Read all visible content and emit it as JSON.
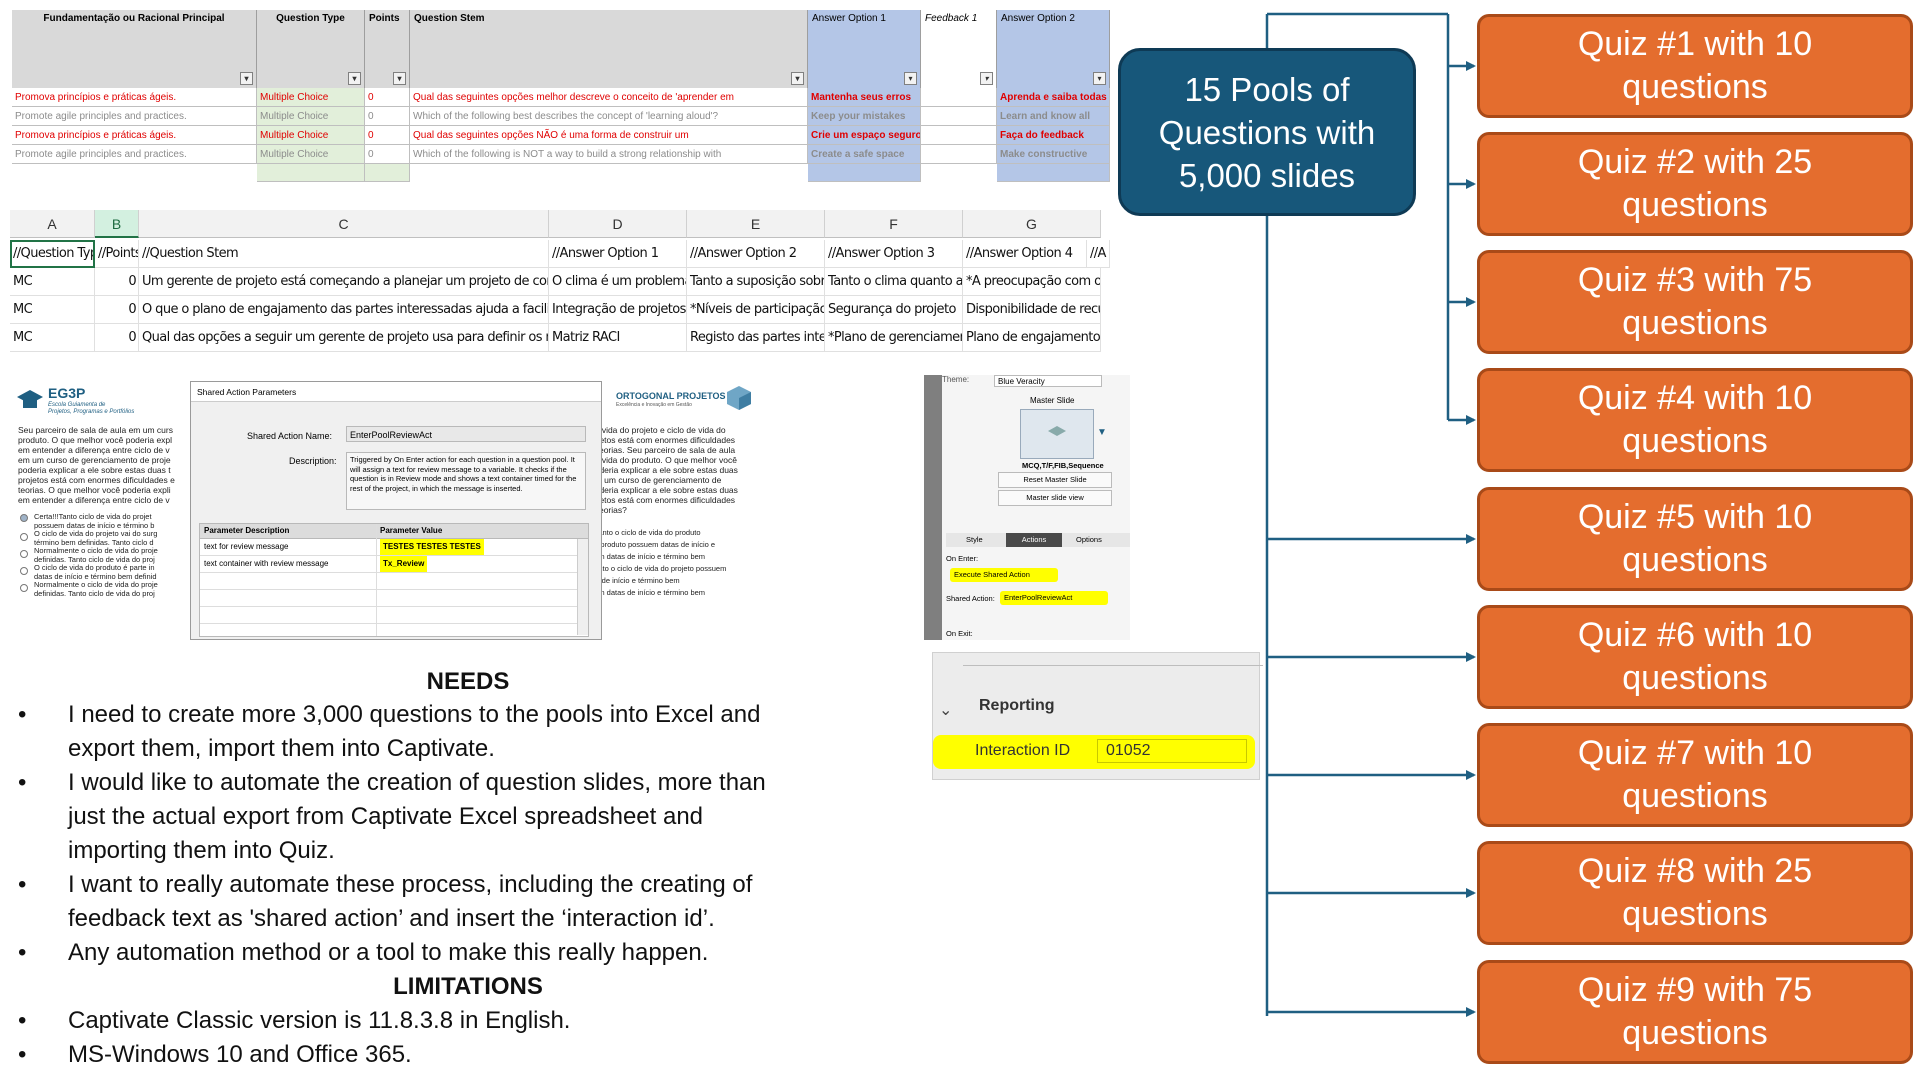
{
  "excel_top": {
    "headers": [
      "Fundamentação ou Racional Principal",
      "Question Type",
      "Points",
      "Question Stem",
      "Answer Option 1",
      "Feedback 1",
      "Answer Option 2"
    ],
    "rows": [
      [
        "Promova princípios e práticas ágeis.",
        "Multiple Choice",
        "0",
        "Qual das seguintes opções melhor descreve o conceito de 'aprender em",
        "Mantenha seus erros",
        "",
        "Aprenda e saiba todas"
      ],
      [
        "Promote agile principles and practices.",
        "Multiple Choice",
        "0",
        "Which of the following best describes the concept of 'learning aloud'?",
        "Keep your mistakes",
        "",
        "Learn and know all"
      ],
      [
        "Promova princípios e práticas ágeis.",
        "Multiple Choice",
        "0",
        "Qual das seguintes opções NÃO é uma forma de construir um",
        "Crie um espaço seguro",
        "",
        "Faça do feedback"
      ],
      [
        "Promote agile principles and practices.",
        "Multiple Choice",
        "0",
        "Which of the following is NOT a way to build a strong relationship with",
        "Create a safe space",
        "",
        "Make constructive"
      ]
    ]
  },
  "excel_bottom": {
    "columns": [
      "A",
      "B",
      "C",
      "D",
      "E",
      "F",
      "G"
    ],
    "header_row": [
      "//Question Type",
      "//Points",
      "//Question Stem",
      "//Answer Option 1",
      "//Answer Option 2",
      "//Answer Option 3",
      "//Answer Option 4",
      "//A"
    ],
    "rows": [
      [
        "MC",
        "0",
        "Um gerente de projeto está começando a planejar um projeto de construção que ocor",
        "O clima é um problema e a li",
        "Tanto a suposição sobre o cli",
        "Tanto o clima quanto a limita",
        "*A preocupação com o clima"
      ],
      [
        "MC",
        "0",
        "O que o plano de engajamento das partes interessadas ajuda a facilitar?",
        "Integração de projetos",
        "*Níveis de participação dese",
        "Segurança do projeto",
        "Disponibilidade de recursos"
      ],
      [
        "MC",
        "0",
        "Qual das opções a seguir um gerente de projeto usa para definir os métodos para ater",
        "Matriz RACI",
        "Registo das partes interessac",
        "*Plano de gerenciamento de",
        "Plano de engajamento das pa"
      ]
    ]
  },
  "captivate": {
    "logo_left": "EG3P",
    "logo_left_sub": [
      "Escola Guiamenta de",
      "Projetos, Programas e Portfólios"
    ],
    "logo_right": "ORTOGONAL PROJETOS",
    "logo_right_sub": "Excelência e Inovação em Gestão",
    "slide_text_left": [
      "Seu parceiro de sala de aula em um curs",
      "produto. O que melhor você poderia expl",
      "em entender a diferença entre ciclo de v",
      "em um curso de gerenciamento de proje",
      "poderia explicar a ele sobre estas duas t",
      "projetos está com enormes dificuldades e",
      "teorias. O que melhor você poderia expli",
      "em entender a diferença entre ciclo de v"
    ],
    "slide_text_right": [
      "de vida do projeto e ciclo de vida do",
      "rojetos está com enormes dificuldades",
      "s teorias. Seu parceiro de sala de aula",
      "de vida do produto. O que melhor você",
      "poderia explicar a ele sobre estas duas",
      "em um curso de gerenciamento de",
      "poderia explicar a ele sobre estas duas",
      "rojetos está com enormes dificuldades",
      "s teorias?"
    ],
    "options_left": [
      "Certa!!!Tanto ciclo de vida do projet",
      "possuem datas de início e término b",
      "O ciclo de vida do projeto vai do surg",
      "término bem definidas. Tanto ciclo d",
      "Normalmente o ciclo de vida do proje",
      "definidas. Tanto ciclo de vida do proj",
      "O ciclo de vida do produto é parte in",
      "datas de início e término bem definid",
      "Normalmente o ciclo de vida do proje",
      "definidas. Tanto ciclo de vida do proj"
    ],
    "options_right": [
      "quanto o ciclo de vida do produto",
      "do produto possuem datas de início e",
      "uem datas de início e término bem",
      "uanto o ciclo de vida do projeto possuem",
      "ias de início e término bem",
      "uem datas de início e término bem"
    ],
    "dialog": {
      "title": "Shared Action Parameters",
      "name_label": "Shared Action Name:",
      "name_value": "EnterPoolReviewAct",
      "desc_label": "Description:",
      "desc_value": "Triggered by On Enter action for each question in a question pool. It will assign a text for review message to a variable. It checks if the question is in Review mode and shows a text container timed for the rest of the project, in which the message is inserted.",
      "col1": "Parameter Description",
      "col2": "Parameter Value",
      "params": [
        [
          "text for review message",
          "TESTES TESTES TESTES"
        ],
        [
          "text container with review message",
          "Tx_Review"
        ]
      ]
    },
    "panel": {
      "theme_label": "Theme:",
      "theme_value": "Blue Veracity",
      "master_label": "Master Slide",
      "master_name": "MCQ,T/F,FIB,Sequence",
      "reset_btn": "Reset Master Slide",
      "view_btn": "Master slide view",
      "tabs": [
        "Style",
        "Actions",
        "Options"
      ],
      "on_enter_label": "On Enter:",
      "on_enter_value": "Execute Shared Action",
      "shared_label": "Shared Action:",
      "shared_value": "EnterPoolReviewAct",
      "on_exit_label": "On Exit:"
    }
  },
  "reporting": {
    "title": "Reporting",
    "label": "Interaction ID",
    "value": "01052"
  },
  "needs": {
    "title": "NEEDS",
    "items": [
      [
        "I need to create more 3,000 questions to the pools into Excel and",
        "export them, import them into Captivate."
      ],
      [
        "I would like to automate the creation of question slides, more than",
        "just the actual export from Captivate Excel spreadsheet and",
        "importing them into Quiz."
      ],
      [
        "I want to really automate these process, including the creating of",
        "feedback text as 'shared action’ and insert the ‘interaction id’."
      ],
      [
        "Any automation method or a tool to make this really happen."
      ]
    ]
  },
  "limitations": {
    "title": "LIMITATIONS",
    "items": [
      [
        "Captivate Classic version is 11.8.3.8 in English."
      ],
      [
        "MS-Windows 10 and Office 365."
      ]
    ]
  },
  "bullet_glyph": "•",
  "pool": {
    "line1": "15 Pools of",
    "line2": "Questions with",
    "line3": "5,000 slides"
  },
  "quizzes": [
    {
      "line1": "Quiz #1 with 10",
      "line2": "questions"
    },
    {
      "line1": "Quiz #2 with 25",
      "line2": "questions"
    },
    {
      "line1": "Quiz #3 with 75",
      "line2": "questions"
    },
    {
      "line1": "Quiz #4 with 10",
      "line2": "questions"
    },
    {
      "line1": "Quiz #5 with 10",
      "line2": "questions"
    },
    {
      "line1": "Quiz #6 with 10",
      "line2": "questions"
    },
    {
      "line1": "Quiz #7 with 10",
      "line2": "questions"
    },
    {
      "line1": "Quiz #8 with 25",
      "line2": "questions"
    },
    {
      "line1": "Quiz #9 with 75",
      "line2": "questions"
    }
  ],
  "colors": {
    "pool_fill": "#17577a",
    "quiz_fill": "#e46d2e",
    "connector": "#1f5f82",
    "highlight": "#ffff00"
  }
}
